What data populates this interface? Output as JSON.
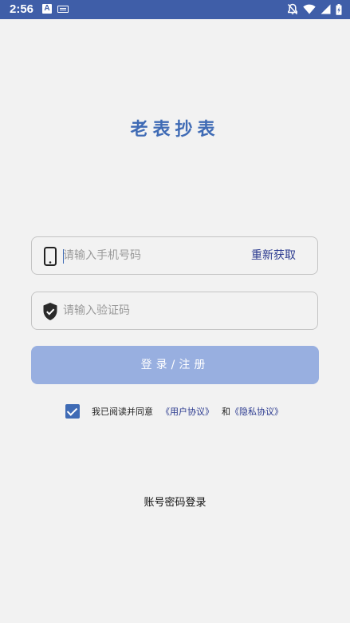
{
  "status_bar": {
    "time": "2:56",
    "icons_left": [
      "a-badge-icon",
      "keyboard-icon"
    ],
    "icons_right": [
      "notifications-off-icon",
      "wifi-icon",
      "cell-signal-icon",
      "battery-icon"
    ]
  },
  "app": {
    "title": "老表抄表"
  },
  "phone_field": {
    "icon": "phone-icon",
    "placeholder": "请输入手机号码",
    "value": "",
    "action_label": "重新获取"
  },
  "code_field": {
    "icon": "shield-check-icon",
    "placeholder": "请输入验证码",
    "value": ""
  },
  "login_button": {
    "label": "登录/注册"
  },
  "agreement": {
    "checked": true,
    "prefix": "我已阅读并同意",
    "user_agreement": "《用户协议》",
    "and": "和",
    "privacy_agreement": "《隐私协议》"
  },
  "alt_login": {
    "label": "账号密码登录"
  },
  "colors": {
    "status_bar": "#3f5ea8",
    "accent": "#3f6bb5",
    "button_bg": "#98afe0",
    "link": "#2b3a8f",
    "background": "#f2f2f2"
  }
}
